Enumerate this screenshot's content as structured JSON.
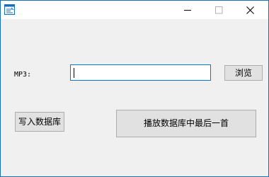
{
  "window": {
    "title": "",
    "icon": "app-icon",
    "controls": {
      "minimize_icon": "minimize-icon",
      "maximize_icon": "maximize-icon",
      "close_icon": "close-icon"
    }
  },
  "form": {
    "mp3_label": "MP3:",
    "file_path_value": "",
    "browse_label": "浏览",
    "write_db_label": "写入数据库",
    "play_last_label": "播放数据库中最后一首"
  },
  "colors": {
    "window_border": "#1a6fb5",
    "titlebar_bg": "#ffffff",
    "client_bg": "#f0f0f0",
    "input_focus_border": "#0078d7",
    "button_bg": "#e1e1e1",
    "button_border": "#adadad"
  }
}
